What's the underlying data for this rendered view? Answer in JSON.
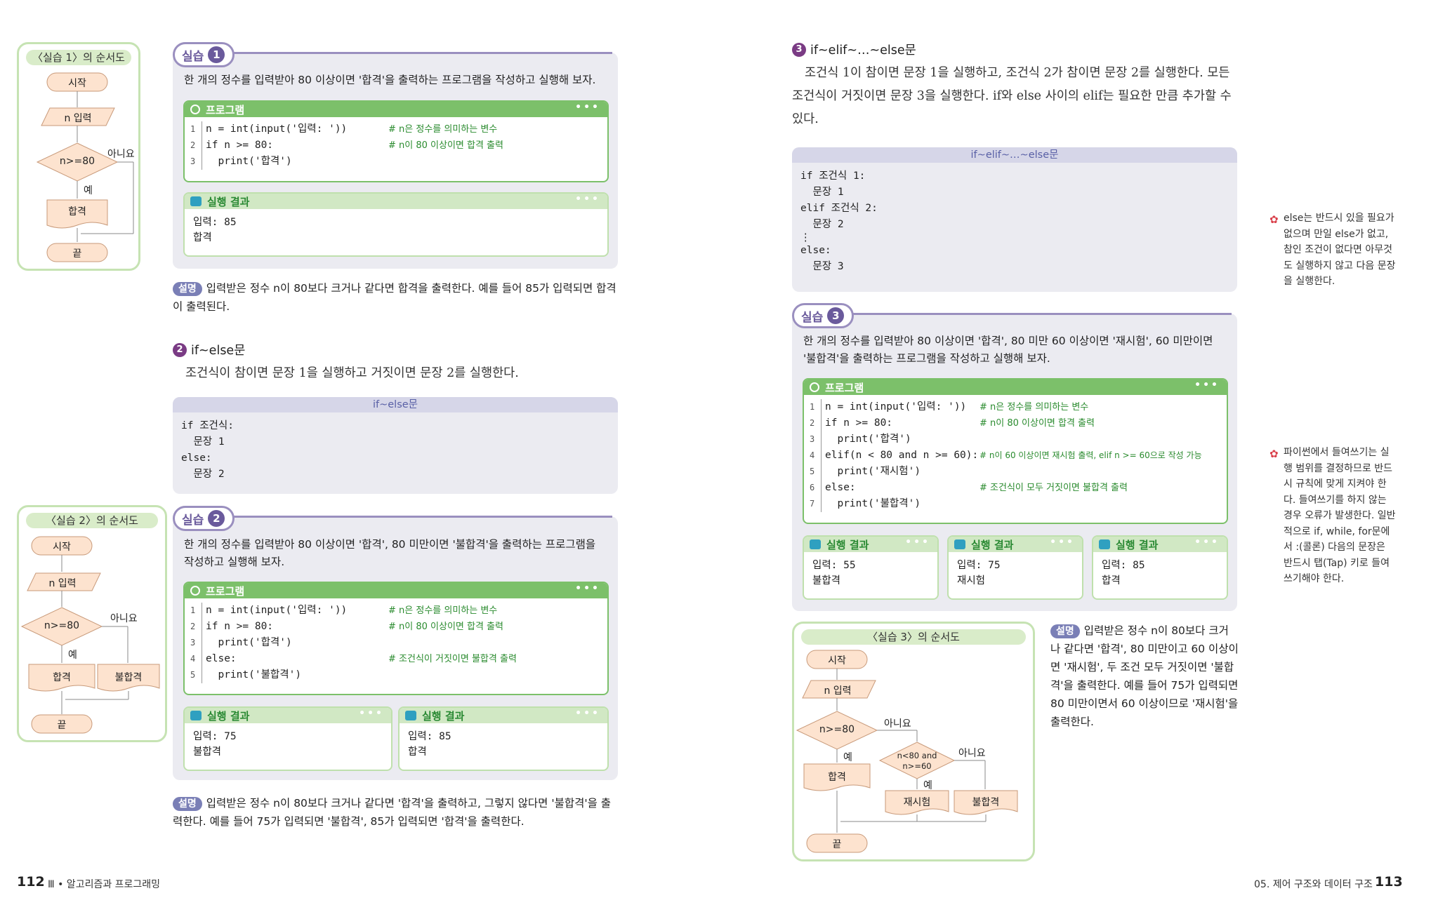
{
  "left_page": {
    "flow1": {
      "title": "〈실습 1〉의 순서도",
      "start": "시작",
      "input": "n 입력",
      "cond": "n>=80",
      "no": "아니요",
      "yes": "예",
      "out": "합격",
      "end": "끝"
    },
    "practice1": {
      "label": "실습",
      "num": "1",
      "task": "한 개의 정수를 입력받아 80 이상이면 '합격'을 출력하는 프로그램을 작성하고 실행해 보자.",
      "program_label": "프로그램",
      "code": [
        {
          "n": "1",
          "c": "n = int(input('입력: '))",
          "m": "# n은 정수를 의미하는 변수"
        },
        {
          "n": "2",
          "c": "if n >= 80:",
          "m": "# n이 80 이상이면 합격 출력"
        },
        {
          "n": "3",
          "c": "  print('합격')",
          "m": ""
        }
      ],
      "result_label": "실행 결과",
      "result": [
        "입력: 85",
        "합격"
      ]
    },
    "expl1": {
      "badge": "설명",
      "text": "입력받은 정수 n이 80보다 크거나 같다면 합격을 출력한다. 예를 들어 85가 입력되면 합격이 출력된다."
    },
    "section2": {
      "num": "2",
      "title": "if~else문",
      "body": "조건식이 참이면 문장 1을 실행하고 거짓이면 문장 2를 실행한다."
    },
    "syntax2": {
      "title": "if~else문",
      "lines": [
        "if 조건식:",
        "  문장 1",
        "else:",
        "  문장 2"
      ]
    },
    "flow2": {
      "title": "〈실습 2〉의 순서도",
      "start": "시작",
      "input": "n 입력",
      "cond": "n>=80",
      "no": "아니요",
      "yes": "예",
      "out1": "합격",
      "out2": "불합격",
      "end": "끝"
    },
    "practice2": {
      "label": "실습",
      "num": "2",
      "task": "한 개의 정수를 입력받아 80 이상이면 '합격', 80 미만이면 '불합격'을 출력하는 프로그램을 작성하고 실행해 보자.",
      "program_label": "프로그램",
      "code": [
        {
          "n": "1",
          "c": "n = int(input('입력: '))",
          "m": "# n은 정수를 의미하는 변수"
        },
        {
          "n": "2",
          "c": "if n >= 80:",
          "m": "# n이 80 이상이면 합격 출력"
        },
        {
          "n": "3",
          "c": "  print('합격')",
          "m": ""
        },
        {
          "n": "4",
          "c": "else:",
          "m": "# 조건식이 거짓이면 불합격 출력"
        },
        {
          "n": "5",
          "c": "  print('불합격')",
          "m": ""
        }
      ],
      "result_label": "실행 결과",
      "results": [
        [
          "입력: 75",
          "불합격"
        ],
        [
          "입력: 85",
          "합격"
        ]
      ]
    },
    "expl2": {
      "badge": "설명",
      "text": "입력받은 정수 n이 80보다 크거나 같다면 '합격'을 출력하고, 그렇지 않다면 '불합격'을 출력한다. 예를 들어 75가 입력되면 '불합격', 85가 입력되면 '합격'을 출력한다."
    },
    "footer": {
      "page": "112",
      "chapter": "Ⅲ • 알고리즘과 프로그래밍"
    }
  },
  "right_page": {
    "section3": {
      "num": "3",
      "title": "if~elif~…~else문",
      "body": "조건식 1이 참이면 문장 1을 실행하고, 조건식 2가 참이면 문장 2를 실행한다. 모든 조건식이 거짓이면 문장 3을 실행한다. if와 else 사이의 elif는 필요한 만큼 추가할 수 있다."
    },
    "syntax3": {
      "title": "if~elif~…~else문",
      "lines": [
        "if 조건식 1:",
        "  문장 1",
        "elif 조건식 2:",
        "  문장 2",
        "⋮",
        "else:",
        "  문장 3"
      ]
    },
    "note1": "else는 반드시 있을 필요가 없으며 만일 else가 없고, 참인 조건이 없다면 아무것도 실행하지 않고 다음 문장을 실행한다.",
    "practice3": {
      "label": "실습",
      "num": "3",
      "task": "한 개의 정수를 입력받아 80 이상이면 '합격', 80 미만 60 이상이면 '재시험', 60 미만이면 '불합격'을 출력하는 프로그램을 작성하고 실행해 보자.",
      "program_label": "프로그램",
      "code": [
        {
          "n": "1",
          "c": "n = int(input('입력: '))",
          "m": "# n은 정수를 의미하는 변수"
        },
        {
          "n": "2",
          "c": "if n >= 80:",
          "m": "# n이 80 이상이면 합격 출력"
        },
        {
          "n": "3",
          "c": "  print('합격')",
          "m": ""
        },
        {
          "n": "4",
          "c": "elif(n < 80 and n >= 60):",
          "m": "# n이 60 이상이면 재시험 출력, elif n >= 60으로 작성 가능"
        },
        {
          "n": "5",
          "c": "  print('재시험')",
          "m": ""
        },
        {
          "n": "6",
          "c": "else:",
          "m": "# 조건식이 모두 거짓이면 불합격 출력"
        },
        {
          "n": "7",
          "c": "  print('불합격')",
          "m": ""
        }
      ],
      "result_label": "실행 결과",
      "results": [
        [
          "입력: 55",
          "불합격"
        ],
        [
          "입력: 75",
          "재시험"
        ],
        [
          "입력: 85",
          "합격"
        ]
      ]
    },
    "note2": "파이썬에서 들여쓰기는 실행 범위를 결정하므로 반드시 규칙에 맞게 지켜야 한다. 들여쓰기를 하지 않는 경우 오류가 발생한다. 일반적으로 if, while, for문에서 :(콜론) 다음의 문장은 반드시 탭(Tap) 키로 들여쓰기해야 한다.",
    "flow3": {
      "title": "〈실습 3〉의 순서도",
      "start": "시작",
      "input": "n 입력",
      "cond1": "n>=80",
      "no1": "아니요",
      "yes1": "예",
      "out1": "합격",
      "cond2a": "n<80 and",
      "cond2b": "n>=60",
      "no2": "아니요",
      "yes2": "예",
      "out2": "재시험",
      "out3": "불합격",
      "end": "끝"
    },
    "expl3": {
      "badge": "설명",
      "text": "입력받은 정수 n이 80보다 크거나 같다면 '합격', 80 미만이고 60 이상이면 '재시험', 두 조건 모두 거짓이면 '불합격'을 출력한다. 예를 들어 75가 입력되면 80 미만이면서 60 이상이므로 '재시험'을 출력한다."
    },
    "footer": {
      "page": "113",
      "chapter": "05. 제어 구조와 데이터 구조"
    }
  }
}
